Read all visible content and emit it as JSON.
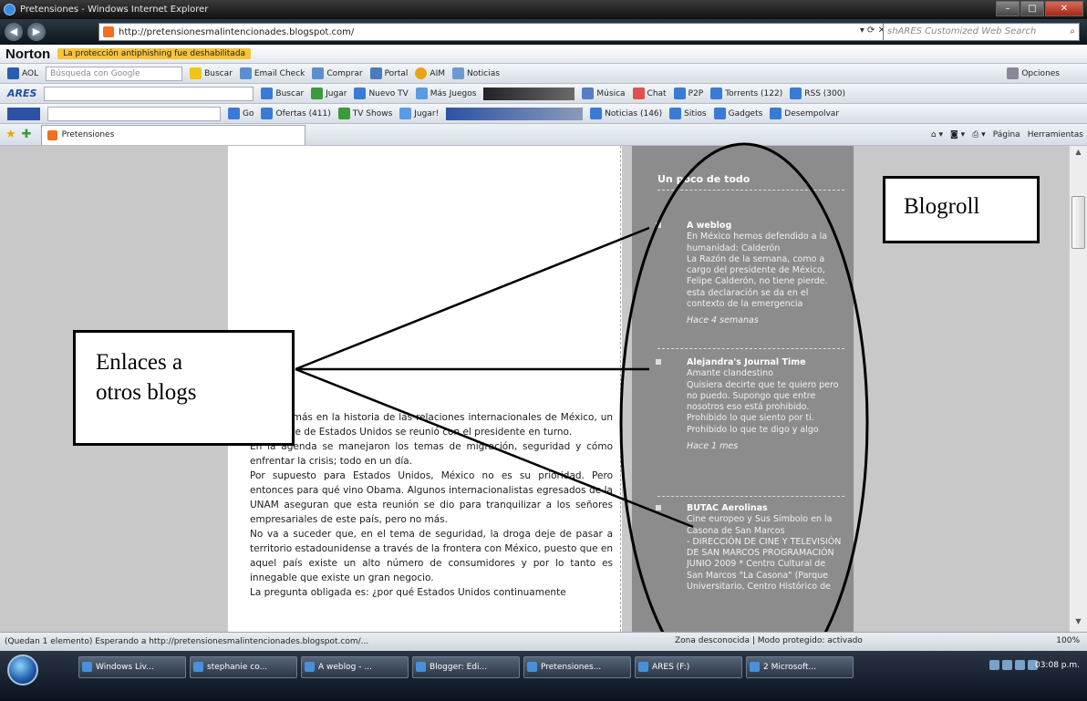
{
  "window": {
    "title": "Pretensiones - Windows Internet Explorer"
  },
  "address_bar": {
    "url": "http://pretensionesmalintencionades.blogspot.com/",
    "search_placeholder": "shARES Customized Web Search"
  },
  "toolbars": {
    "norton": {
      "logo": "Norton",
      "message": "La protección antiphishing fue deshabilitada"
    },
    "aol": {
      "aol_label": "AOL",
      "search_hint": "Búsqueda con Google",
      "buscar": "Buscar",
      "items": [
        "Email Check",
        "Comprar",
        "Portal",
        "AIM",
        "Noticias"
      ],
      "right": "Opciones"
    },
    "ares": {
      "logo": "ARES",
      "buscar": "Buscar",
      "items": [
        "Jugar",
        "Nuevo TV",
        "Más Juegos",
        "Música",
        "Chat",
        "P2P",
        "Torrents (122)",
        "RSS (300)"
      ]
    },
    "toolbar4": {
      "go": "Go",
      "items": [
        "Ofertas (411)",
        "TV Shows",
        "Jugar!",
        "Noticias (146)",
        "Sitios",
        "Gadgets",
        "Desempolvar"
      ]
    },
    "tabs": {
      "active": "Pretensiones",
      "commands": [
        "Página",
        "Herramientas"
      ]
    }
  },
  "post": {
    "paragraphs": [
      "Una vez más en la historia de las relaciones internacionales de México, un presidente de Estados Unidos se reunió con el presidente en turno.",
      "En la agenda se manejaron los temas de migración, seguridad y cómo enfrentar la crisis; todo en un día.",
      "Por supuesto para Estados Unidos, México no es su prioridad. Pero entonces para qué vino Obama. Algunos internacionalistas egresados de la UNAM aseguran que esta reunión se dio para tranquilizar a los señores empresariales de este país, pero no más.",
      "No va a suceder que, en el tema de seguridad, la droga deje de pasar a territorio estadounidense a través de la frontera con México, puesto que en aquel país existe un alto número de consumidores y por lo tanto es innegable que existe un gran negocio.",
      "La pregunta obligada es: ¿por qué Estados Unidos continuamente"
    ]
  },
  "sidebar": {
    "title": "Un poco de todo",
    "entries": [
      {
        "name": "A weblog",
        "title": "En México hemos defendido a la humanidad: Calderón",
        "snippet": "La Razón de la semana, como a cargo del presidente de México, Felipe Calderón, no tiene pierde. esta declaración se da en el contexto de la emergencia",
        "ago": "Hace 4 semanas"
      },
      {
        "name": "Alejandra's Journal Time",
        "title": "Amante clandestino",
        "snippet": "Quisiera decirte que te quiero pero no puedo. Supongo que entre nosotros eso está prohibido. Prohibido lo que siento por ti. Prohibido lo que te digo y algo",
        "ago": "Hace 1 mes"
      },
      {
        "name": "BUTAC Aerolinas",
        "title": "Cine europeo y Sus Símbolo en la Casona de San Marcos",
        "snippet": "- DIRECCIÓN DE CINE Y TELEVISIÓN DE SAN MARCOS PROGRAMACIÓN JUNIO 2009 * Centro Cultural de San Marcos \"La Casona\" (Parque Universitario, Centro Histórico de",
        "ago": ""
      }
    ]
  },
  "annotations": {
    "blogroll": "Blogroll",
    "links": [
      "Enlaces a",
      "otros blogs"
    ]
  },
  "statusbar": {
    "text": "(Quedan 1 elemento) Esperando a http://pretensionesmalintencionades.blogspot.com/...",
    "zone": "Zona desconocida | Modo protegido: activado",
    "zoom": "100%"
  },
  "taskbar": {
    "tasks": [
      "Windows Liv...",
      "stephanie co...",
      "A weblog - ...",
      "Blogger: Edi...",
      "Pretensiones...",
      "ARES (F:)",
      "2 Microsoft..."
    ],
    "clock": "03:08 p.m."
  }
}
